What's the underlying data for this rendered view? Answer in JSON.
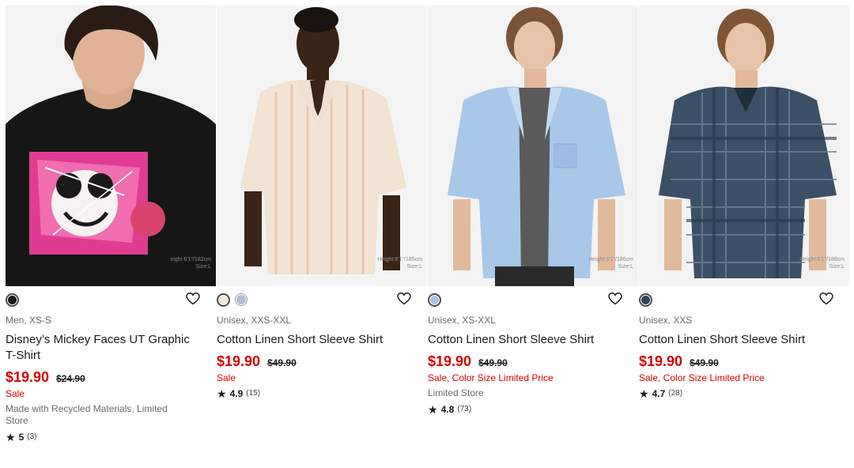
{
  "products": [
    {
      "photo_note_line1": "eight 6'1\"/182cm",
      "photo_note_line2": "Size:L",
      "swatches": [
        "#1a1a1a"
      ],
      "favorite_icon": "heart-outline-icon",
      "meta": "Men, XS-S",
      "name": "Disney’s Mickey Faces UT Graphic T-Shirt",
      "price": "$19.90",
      "original_price": "$24.90",
      "flags": "Sale",
      "extra": "Made with Recycled Materials, Limited Store",
      "rating": "5",
      "rating_count": "(3)"
    },
    {
      "photo_note_line1": "Height:6'1\"/185cm",
      "photo_note_line2": "Size:L",
      "swatches": [
        "#efe7dc",
        "#aebfd6"
      ],
      "favorite_icon": "heart-outline-icon",
      "meta": "Unisex, XXS-XXL",
      "name": "Cotton Linen Short Sleeve Shirt",
      "price": "$19.90",
      "original_price": "$49.90",
      "flags": "Sale",
      "extra": "",
      "rating": "4.9",
      "rating_count": "(15)"
    },
    {
      "photo_note_line1": "Height:6'1\"/186cm",
      "photo_note_line2": "Size:L",
      "swatches": [
        "#a8c4e3"
      ],
      "favorite_icon": "heart-outline-icon",
      "meta": "Unisex, XS-XXL",
      "name": "Cotton Linen Short Sleeve Shirt",
      "price": "$19.90",
      "original_price": "$49.90",
      "flags": "Sale, Color Size Limited Price",
      "extra": "Limited Store",
      "rating": "4.8",
      "rating_count": "(73)"
    },
    {
      "photo_note_line1": "Height:6'1\"/186cm",
      "photo_note_line2": "Size:L",
      "swatches": [
        "#2f4257"
      ],
      "favorite_icon": "heart-outline-icon",
      "meta": "Unisex, XXS",
      "name": "Cotton Linen Short Sleeve Shirt",
      "price": "$19.90",
      "original_price": "$49.90",
      "flags": "Sale, Color Size Limited Price",
      "extra": "",
      "rating": "4.7",
      "rating_count": "(28)"
    }
  ],
  "colors": {
    "sale_red": "#d60000",
    "text": "#1b1b1b",
    "muted": "#6b6b6b"
  }
}
